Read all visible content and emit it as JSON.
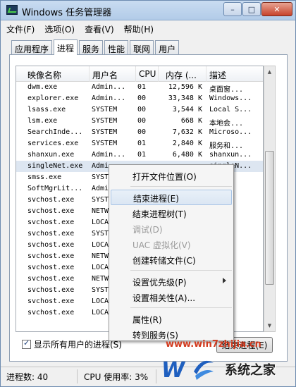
{
  "window": {
    "title": "Windows 任务管理器",
    "min_label": "–",
    "max_label": "□",
    "close_label": "✕"
  },
  "menu": [
    "文件(F)",
    "选项(O)",
    "查看(V)",
    "帮助(H)"
  ],
  "tabs": [
    "应用程序",
    "进程",
    "服务",
    "性能",
    "联网",
    "用户"
  ],
  "active_tab": "进程",
  "columns": [
    "映像名称",
    "用户名",
    "CPU",
    "内存 (...",
    "描述"
  ],
  "processes": [
    {
      "name": "dwm.exe",
      "user": "Admin...",
      "cpu": "01",
      "mem": "12,596 K",
      "desc": "桌面窗..."
    },
    {
      "name": "explorer.exe",
      "user": "Admin...",
      "cpu": "00",
      "mem": "33,348 K",
      "desc": "Windows..."
    },
    {
      "name": "lsass.exe",
      "user": "SYSTEM",
      "cpu": "00",
      "mem": "3,544 K",
      "desc": "Local S..."
    },
    {
      "name": "lsm.exe",
      "user": "SYSTEM",
      "cpu": "00",
      "mem": "668 K",
      "desc": "本地会..."
    },
    {
      "name": "SearchInde...",
      "user": "SYSTEM",
      "cpu": "00",
      "mem": "7,632 K",
      "desc": "Microso..."
    },
    {
      "name": "services.exe",
      "user": "SYSTEM",
      "cpu": "01",
      "mem": "2,840 K",
      "desc": "服务和..."
    },
    {
      "name": "shanxun.exe",
      "user": "Admin...",
      "cpu": "01",
      "mem": "6,480 K",
      "desc": "shanxun..."
    },
    {
      "name": "singleNet.exe",
      "user": "Admi",
      "cpu": "",
      "mem": "",
      "desc": "singleN..."
    },
    {
      "name": "smss.exe",
      "user": "SYST",
      "cpu": "",
      "mem": "",
      "desc": ""
    },
    {
      "name": "SoftMgrLit...",
      "user": "Admi",
      "cpu": "",
      "mem": "",
      "desc": ""
    },
    {
      "name": "svchost.exe",
      "user": "SYST",
      "cpu": "",
      "mem": "",
      "desc": ""
    },
    {
      "name": "svchost.exe",
      "user": "NETW",
      "cpu": "",
      "mem": "",
      "desc": ""
    },
    {
      "name": "svchost.exe",
      "user": "LOCA",
      "cpu": "",
      "mem": "",
      "desc": ""
    },
    {
      "name": "svchost.exe",
      "user": "SYST",
      "cpu": "",
      "mem": "",
      "desc": ""
    },
    {
      "name": "svchost.exe",
      "user": "LOCA",
      "cpu": "",
      "mem": "",
      "desc": ""
    },
    {
      "name": "svchost.exe",
      "user": "NETW",
      "cpu": "",
      "mem": "",
      "desc": ""
    },
    {
      "name": "svchost.exe",
      "user": "LOCA",
      "cpu": "",
      "mem": "",
      "desc": ""
    },
    {
      "name": "svchost.exe",
      "user": "NETW",
      "cpu": "",
      "mem": "",
      "desc": ""
    },
    {
      "name": "svchost.exe",
      "user": "SYST",
      "cpu": "",
      "mem": "",
      "desc": ""
    },
    {
      "name": "svchost.exe",
      "user": "LOCA",
      "cpu": "",
      "mem": "",
      "desc": ""
    },
    {
      "name": "svchost.exe",
      "user": "LOCA",
      "cpu": "",
      "mem": "",
      "desc": ""
    }
  ],
  "selected_index": 7,
  "show_all_label": "显示所有用户的进程(S)",
  "end_process_button": "结束进程(E)",
  "status": {
    "process_count": "进程数: 40",
    "cpu_usage": "CPU 使用率: 3%"
  },
  "context_menu": {
    "items": [
      {
        "label": "打开文件位置(O)",
        "kind": "item"
      },
      {
        "kind": "separator"
      },
      {
        "label": "结束进程(E)",
        "kind": "item",
        "highlighted": true
      },
      {
        "label": "结束进程树(T)",
        "kind": "item"
      },
      {
        "label": "调试(D)",
        "kind": "item",
        "disabled": true
      },
      {
        "label": "UAC 虚拟化(V)",
        "kind": "item",
        "disabled": true
      },
      {
        "label": "创建转储文件(C)",
        "kind": "item"
      },
      {
        "kind": "separator"
      },
      {
        "label": "设置优先级(P)",
        "kind": "item",
        "submenu": true
      },
      {
        "label": "设置相关性(A)...",
        "kind": "item"
      },
      {
        "kind": "separator"
      },
      {
        "label": "属性(R)",
        "kind": "item"
      },
      {
        "label": "转到服务(S)",
        "kind": "item"
      }
    ]
  },
  "watermark": {
    "url": "www.win7zhijia.cn",
    "text": "系统之家"
  },
  "colors": {
    "selected_row": "#dde6f1",
    "highlight": "#dbe6f3",
    "watermark_red": "#d23a1e",
    "logo_blue": "#1f5fbf"
  }
}
